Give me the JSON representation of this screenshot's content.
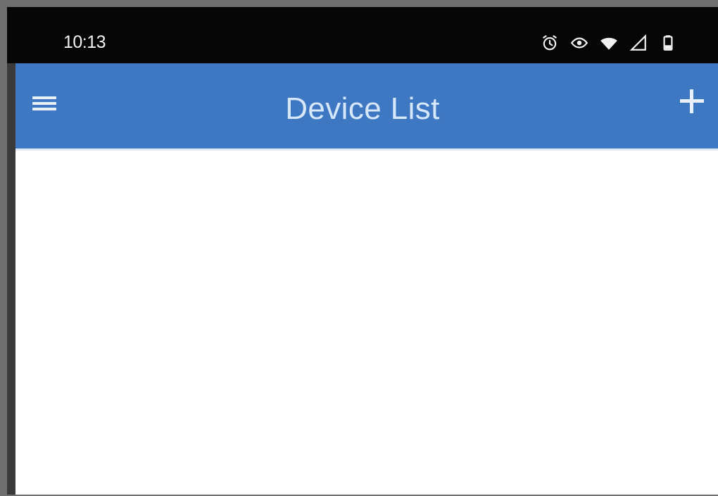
{
  "status_bar": {
    "time": "10:13",
    "icons": [
      "alarm-icon",
      "eye-icon",
      "wifi-icon",
      "signal-icon",
      "battery-icon"
    ]
  },
  "app_bar": {
    "title": "Device List",
    "menu_icon": "hamburger-menu-icon",
    "add_icon": "plus-icon"
  },
  "colors": {
    "status_bar_bg": "#060606",
    "app_bar_bg": "#3f78c2",
    "title_text": "#d7e7fa",
    "content_bg": "#ffffff"
  },
  "device_list": {
    "items": []
  }
}
